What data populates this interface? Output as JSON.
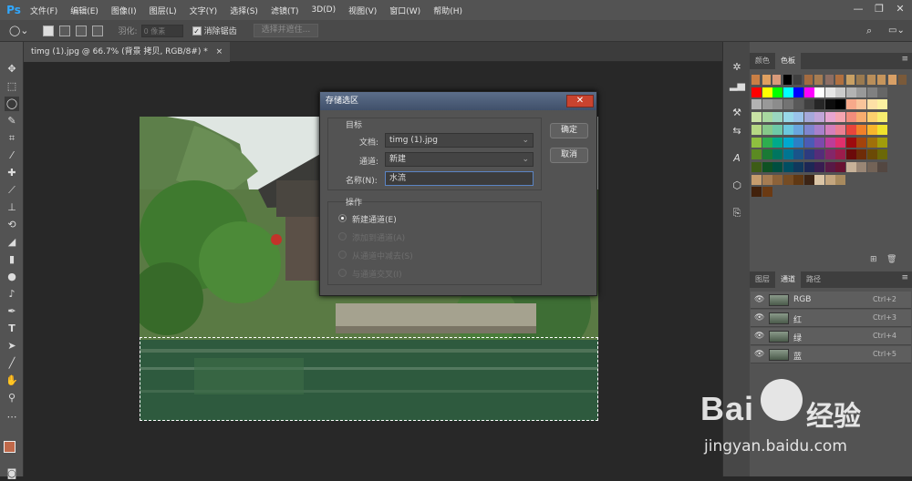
{
  "app": {
    "logo": "Ps"
  },
  "menu": [
    "文件(F)",
    "编辑(E)",
    "图像(I)",
    "图层(L)",
    "文字(Y)",
    "选择(S)",
    "滤镜(T)",
    "3D(D)",
    "视图(V)",
    "窗口(W)",
    "帮助(H)"
  ],
  "window_controls": {
    "minimize": "—",
    "restore": "❐",
    "close": "✕"
  },
  "options": {
    "feather_label": "羽化:",
    "feather_value": "0 像素",
    "antialias_label": "消除锯齿",
    "select_mask_button": "选择并遮住..."
  },
  "document": {
    "tab_title": "timg (1).jpg @ 66.7% (背景 拷贝, RGB/8#) *",
    "close": "×"
  },
  "dialog": {
    "title": "存储选区",
    "close": "✕",
    "target_group": "目标",
    "document_label": "文档:",
    "document_value": "timg (1).jpg",
    "channel_label": "通道:",
    "channel_value": "新建",
    "name_label": "名称(N):",
    "name_value": "水流",
    "operation_group": "操作",
    "ok": "确定",
    "cancel": "取消",
    "operations": [
      "新建通道(E)",
      "添加到通道(A)",
      "从通道中减去(S)",
      "与通道交叉(I)"
    ],
    "selected_operation": 0
  },
  "color_panel": {
    "tabs": [
      "颜色",
      "色板"
    ],
    "active_tab": 1
  },
  "channels_panel": {
    "tabs": [
      "图层",
      "通道",
      "路径"
    ],
    "active_tab": 1,
    "channels": [
      {
        "name": "RGB",
        "shortcut": "Ctrl+2"
      },
      {
        "name": "红",
        "shortcut": "Ctrl+3"
      },
      {
        "name": "绿",
        "shortcut": "Ctrl+4"
      },
      {
        "name": "蓝",
        "shortcut": "Ctrl+5"
      }
    ]
  },
  "swatches": [
    [
      "#c97f45",
      "#e0a060",
      "#d89a7a",
      "#000000",
      "#404040",
      "#a36b40",
      "#a67c52",
      "#8d6e63",
      "#b07040",
      "#c8a064",
      "#9a7a50",
      "#b98e5a",
      "#c6955c",
      "#d9a066",
      "#7a5a3a"
    ],
    [
      "#ff0000",
      "#ffff00",
      "#00ff00",
      "#00ffff",
      "#0000ff",
      "#ff00ff",
      "#ffffff",
      "#e6e6e6",
      "#cccccc",
      "#b3b3b3",
      "#999999",
      "#808080",
      "#666666"
    ],
    [
      "#b3b3b3",
      "#999999",
      "#8c8c8c",
      "#737373",
      "#595959",
      "#404040",
      "#262626",
      "#0d0d0d",
      "#000000",
      "#f7a98a",
      "#f9c49a",
      "#fde0a6",
      "#fbf0a0"
    ],
    [
      "#c9e3a5",
      "#a8d8a0",
      "#9ad6c0",
      "#98d8e8",
      "#9ac3ea",
      "#a5a8da",
      "#c2a5d8",
      "#e8a5d0",
      "#f5a5b0",
      "#f28d7c",
      "#f7ad6f",
      "#fbd06e",
      "#f6ed6f"
    ],
    [
      "#b6d884",
      "#86c98a",
      "#6ec9a8",
      "#6bc7dd",
      "#6aa6de",
      "#7f85cf",
      "#a880cb",
      "#d47fbb",
      "#ea7f92",
      "#e8453c",
      "#f0802a",
      "#f7b52c",
      "#efe22d"
    ],
    [
      "#8ebf3f",
      "#2eae4f",
      "#00a98b",
      "#00a8cf",
      "#2d7fc5",
      "#4b5bb5",
      "#7d4aab",
      "#bd3d98",
      "#e1306c",
      "#9e0b0f",
      "#a3430c",
      "#a0700a",
      "#a19c0b"
    ],
    [
      "#5b8a22",
      "#1a7a35",
      "#007560",
      "#007592",
      "#1a548a",
      "#2d3b7f",
      "#552d79",
      "#842669",
      "#9c1c4b",
      "#6b0a0a",
      "#6e2c08",
      "#6b4a06",
      "#6b6807"
    ],
    [
      "#3d5c16",
      "#0f5123",
      "#004e40",
      "#004e62",
      "#10385c",
      "#1d2755",
      "#381d51",
      "#581946",
      "#681232",
      "#c7b299",
      "#998675",
      "#736357",
      "#534741"
    ],
    [
      "#c69c6d",
      "#a67c52",
      "#8c6239",
      "#754c24",
      "#603813",
      "#3c2415",
      "#dbc5a6",
      "#c4a67f",
      "#a88a5e"
    ],
    [
      "#42210b",
      "#6b3a13"
    ]
  ],
  "watermark": {
    "brand": "Bai",
    "brand2": "经验",
    "url": "jingyan.baidu.com"
  }
}
